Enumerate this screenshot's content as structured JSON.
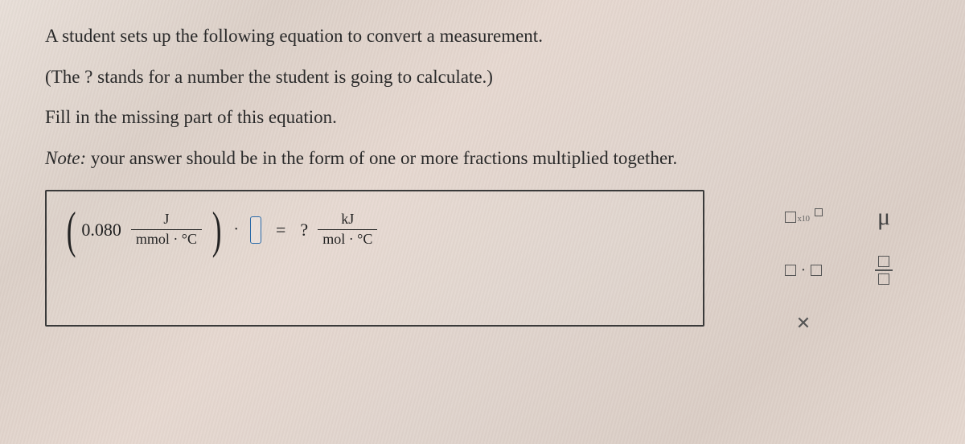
{
  "prompt": {
    "line1": "A student sets up the following equation to convert a measurement.",
    "line2": "(The ? stands for a number the student is going to calculate.)",
    "line3": "Fill in the missing part of this equation.",
    "note_label": "Note:",
    "note_text": " your answer should be in the form of one or more fractions multiplied together."
  },
  "equation": {
    "coefficient": "0.080",
    "left_frac": {
      "num": "J",
      "den": "mmol · °C"
    },
    "dot": "·",
    "equals": "=",
    "question": "?",
    "right_frac": {
      "num": "kJ",
      "den": "mol · °C"
    }
  },
  "palette": {
    "sci_label": "x10",
    "mu": "μ",
    "mult_dot": "·",
    "close": "✕"
  }
}
